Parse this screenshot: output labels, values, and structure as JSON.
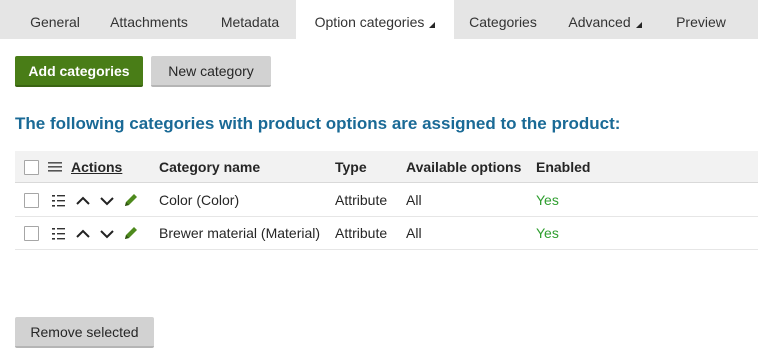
{
  "tabs": [
    {
      "label": "General"
    },
    {
      "label": "Attachments"
    },
    {
      "label": "Metadata"
    },
    {
      "label": "Option categories"
    },
    {
      "label": "Categories"
    },
    {
      "label": "Advanced"
    },
    {
      "label": "Preview"
    }
  ],
  "toolbar": {
    "add_categories": "Add categories",
    "new_category": "New category"
  },
  "heading": "The following categories with product options are assigned to the product:",
  "grid": {
    "columns": {
      "actions": "Actions",
      "category_name": "Category name",
      "type": "Type",
      "available_options": "Available options",
      "enabled": "Enabled"
    },
    "rows": [
      {
        "category_name": "Color (Color)",
        "type": "Attribute",
        "available_options": "All",
        "enabled": "Yes"
      },
      {
        "category_name": "Brewer material (Material)",
        "type": "Attribute",
        "available_options": "All",
        "enabled": "Yes"
      }
    ]
  },
  "footer": {
    "remove_selected": "Remove selected"
  },
  "colors": {
    "accent_green": "#497d17",
    "heading_blue": "#1a6a96",
    "enabled_green": "#2f9e2f"
  },
  "icons": [
    "select-all-checkbox",
    "column-menu-icon",
    "options-list-icon",
    "move-up-icon",
    "move-down-icon",
    "edit-pencil-icon",
    "dropdown-caret-icon"
  ]
}
